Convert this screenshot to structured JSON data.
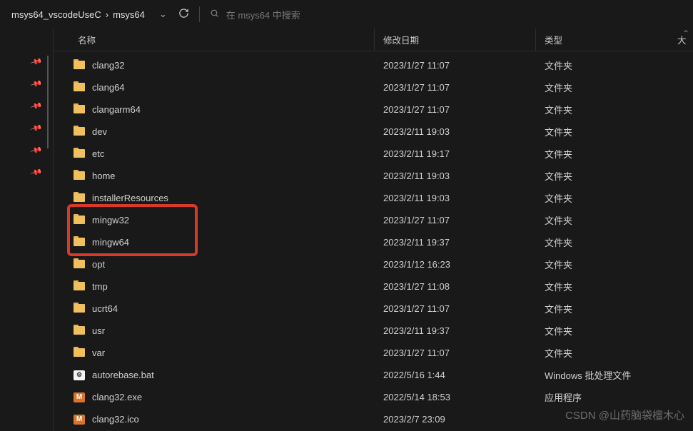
{
  "breadcrumb": {
    "item1": "msys64_vscodeUseC",
    "item2": "msys64"
  },
  "search": {
    "placeholder": "在 msys64 中搜索"
  },
  "columns": {
    "name": "名称",
    "date": "修改日期",
    "type": "类型",
    "size": "大"
  },
  "rows": [
    {
      "icon": "folder",
      "name": "clang32",
      "date": "2023/1/27 11:07",
      "type": "文件夹"
    },
    {
      "icon": "folder",
      "name": "clang64",
      "date": "2023/1/27 11:07",
      "type": "文件夹"
    },
    {
      "icon": "folder",
      "name": "clangarm64",
      "date": "2023/1/27 11:07",
      "type": "文件夹"
    },
    {
      "icon": "folder",
      "name": "dev",
      "date": "2023/2/11 19:03",
      "type": "文件夹"
    },
    {
      "icon": "folder",
      "name": "etc",
      "date": "2023/2/11 19:17",
      "type": "文件夹"
    },
    {
      "icon": "folder",
      "name": "home",
      "date": "2023/2/11 19:03",
      "type": "文件夹"
    },
    {
      "icon": "folder",
      "name": "installerResources",
      "date": "2023/2/11 19:03",
      "type": "文件夹"
    },
    {
      "icon": "folder",
      "name": "mingw32",
      "date": "2023/1/27 11:07",
      "type": "文件夹"
    },
    {
      "icon": "folder",
      "name": "mingw64",
      "date": "2023/2/11 19:37",
      "type": "文件夹"
    },
    {
      "icon": "folder",
      "name": "opt",
      "date": "2023/1/12 16:23",
      "type": "文件夹"
    },
    {
      "icon": "folder",
      "name": "tmp",
      "date": "2023/1/27 11:08",
      "type": "文件夹"
    },
    {
      "icon": "folder",
      "name": "ucrt64",
      "date": "2023/1/27 11:07",
      "type": "文件夹"
    },
    {
      "icon": "folder",
      "name": "usr",
      "date": "2023/2/11 19:37",
      "type": "文件夹"
    },
    {
      "icon": "folder",
      "name": "var",
      "date": "2023/1/27 11:07",
      "type": "文件夹"
    },
    {
      "icon": "bat",
      "name": "autorebase.bat",
      "date": "2022/5/16 1:44",
      "type": "Windows 批处理文件"
    },
    {
      "icon": "m",
      "name": "clang32.exe",
      "date": "2022/5/14 18:53",
      "type": "应用程序"
    },
    {
      "icon": "m",
      "name": "clang32.ico",
      "date": "2023/2/7 23:09",
      "type": ""
    }
  ],
  "watermark": "CSDN @山药脑袋檀木心"
}
